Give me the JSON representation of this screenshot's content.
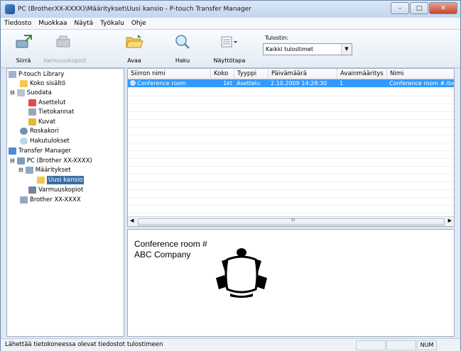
{
  "window": {
    "title": "PC (BrotherXX-XXXX)\\Määritykset\\Uusi kansio - P-touch Transfer Manager"
  },
  "menu": [
    "Tiedosto",
    "Muokkaa",
    "Näytä",
    "Työkalu",
    "Ohje"
  ],
  "toolbar": {
    "transfer": "Siirrä",
    "backup": "Varmuuskopiot",
    "open": "Avaa",
    "search": "Haku",
    "view": "Näyttötapa",
    "printer_label": "Tulostin:",
    "printer_value": "Kaikki tulostimet"
  },
  "tree": {
    "library": "P-touch Library",
    "all": "Koko sisältö",
    "filter": "Suodata",
    "layouts": "Asettelut",
    "databases": "Tietokannat",
    "images": "Kuvat",
    "trash": "Roskakori",
    "search_results": "Hakutulokset",
    "transfer_manager": "Transfer Manager",
    "pc": "PC (Brother XX-XXXX)",
    "configs": "Määritykset",
    "new_folder": "Uusi kansio",
    "backups": "Varmuuskopiot",
    "brother": "Brother XX-XXXX"
  },
  "table": {
    "columns": [
      "Siirron nimi",
      "Koko",
      "Tyyppi",
      "Päivämäärä",
      "Avainmääritys",
      "Nimi"
    ],
    "rows": [
      [
        "Conference room",
        "1kt",
        "Asettelu",
        "2.10.2009 14:28:30",
        "1",
        "Conference room #.lbx"
      ]
    ],
    "scroll_grip": "III"
  },
  "preview": {
    "line1": "Conference room #",
    "line2": "ABC Company"
  },
  "status": {
    "text": "Lähettää tietokoneessa olevat tiedostot tulostimeen",
    "num": "NUM"
  }
}
